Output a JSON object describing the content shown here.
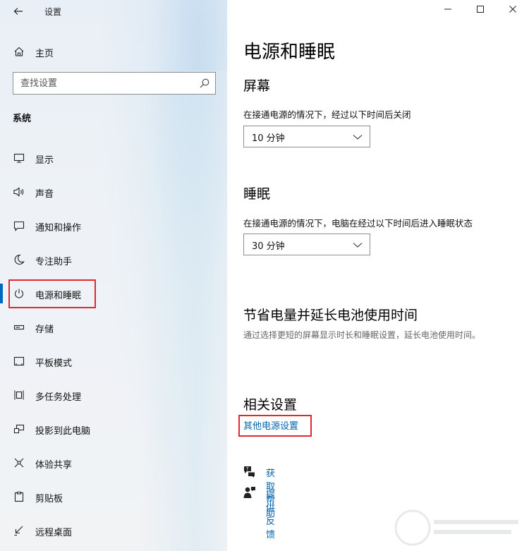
{
  "app": {
    "title": "设置"
  },
  "window": {
    "minimize": "—",
    "maximize": "☐",
    "close": "✕"
  },
  "sidebar": {
    "home_label": "主页",
    "search_placeholder": "查找设置",
    "section_title": "系统",
    "items": [
      {
        "label": "显示",
        "icon": "monitor-icon"
      },
      {
        "label": "声音",
        "icon": "speaker-icon"
      },
      {
        "label": "通知和操作",
        "icon": "notification-icon"
      },
      {
        "label": "专注助手",
        "icon": "moon-icon"
      },
      {
        "label": "电源和睡眠",
        "icon": "power-icon",
        "active": true
      },
      {
        "label": "存储",
        "icon": "storage-icon"
      },
      {
        "label": "平板模式",
        "icon": "tablet-icon"
      },
      {
        "label": "多任务处理",
        "icon": "multitask-icon"
      },
      {
        "label": "投影到此电脑",
        "icon": "project-icon"
      },
      {
        "label": "体验共享",
        "icon": "share-icon"
      },
      {
        "label": "剪贴板",
        "icon": "clipboard-icon"
      },
      {
        "label": "远程桌面",
        "icon": "remote-icon"
      }
    ]
  },
  "main": {
    "title": "电源和睡眠",
    "screen": {
      "heading": "屏幕",
      "desc": "在接通电源的情况下，经过以下时间后关闭",
      "value": "10 分钟"
    },
    "sleep": {
      "heading": "睡眠",
      "desc": "在接通电源的情况下，电脑在经过以下时间后进入睡眠状态",
      "value": "30 分钟"
    },
    "battery": {
      "heading": "节省电量并延长电池使用时间",
      "desc": "通过选择更短的屏幕显示时长和睡眠设置，延长电池使用时间。"
    },
    "related": {
      "heading": "相关设置",
      "link": "其他电源设置"
    },
    "help": {
      "get_help": "获取帮助",
      "feedback": "提供反馈"
    }
  },
  "colors": {
    "accent": "#0067c0",
    "link": "#0063b1",
    "highlight": "#e0282e"
  }
}
